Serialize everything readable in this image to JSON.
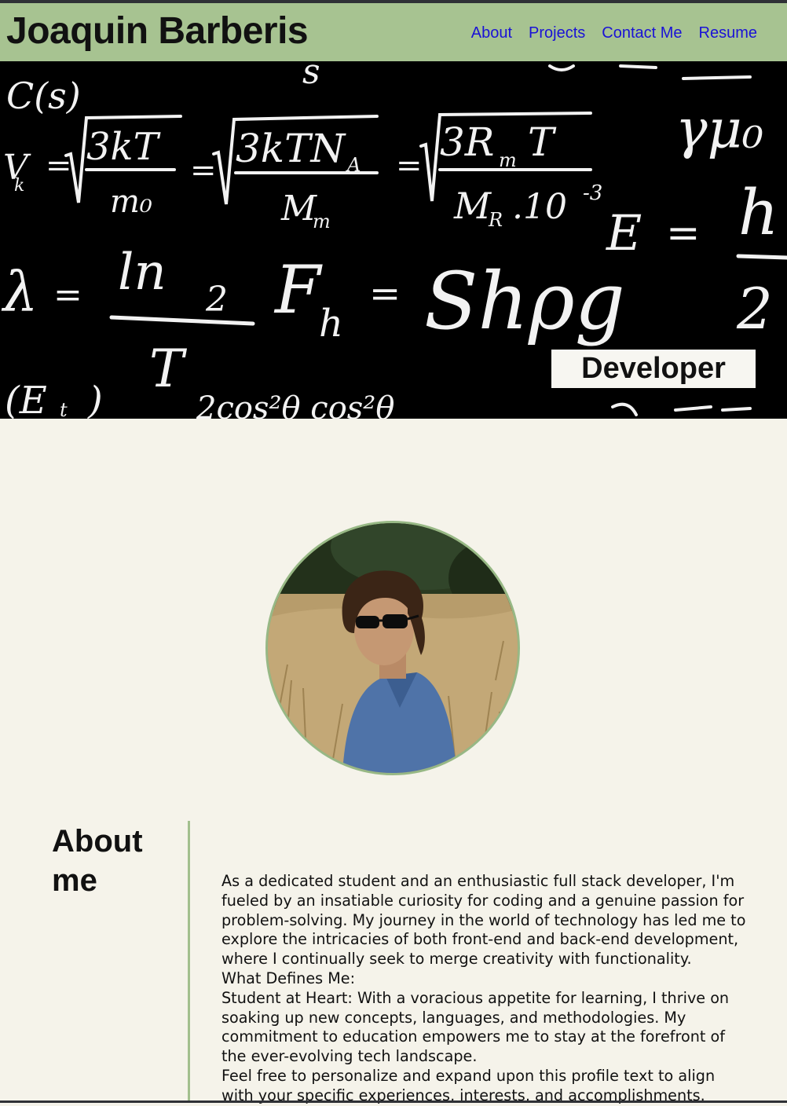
{
  "header": {
    "title": "Joaquin Barberis",
    "nav": [
      "About",
      "Projects",
      "Contact Me",
      "Resume"
    ]
  },
  "hero": {
    "badge": "Developer",
    "formulas": [
      "C(s)",
      "v = √(3kT/m₀) = √(3kTN_A/M_m) = √(3R_mT/M_R·10⁻³)",
      "λ = ln2 / T",
      "F_h = Shρg",
      "E = h",
      "(E_t)"
    ]
  },
  "profile": {
    "photo": "profile-photo"
  },
  "about": {
    "heading": "About me",
    "paragraphs": [
      "As a dedicated student and an enthusiastic full stack developer, I'm fueled by an insatiable curiosity for coding and a genuine passion for problem-solving. My journey in the world of technology has led me to explore the intricacies of both front-end and back-end development, where I continually seek to merge creativity with functionality.",
      "What Defines Me:",
      "Student at Heart: With a voracious appetite for learning, I thrive on soaking up new concepts, languages, and methodologies. My commitment to education empowers me to stay at the forefront of the ever-evolving tech landscape.",
      "Feel free to personalize and expand upon this profile text to align with your specific experiences, interests, and accomplishments."
    ]
  },
  "colors": {
    "header_bg": "#a7c391",
    "page_bg": "#f5f3ea",
    "nav_link": "#1a12d6",
    "accent": "#a2bf8d"
  }
}
